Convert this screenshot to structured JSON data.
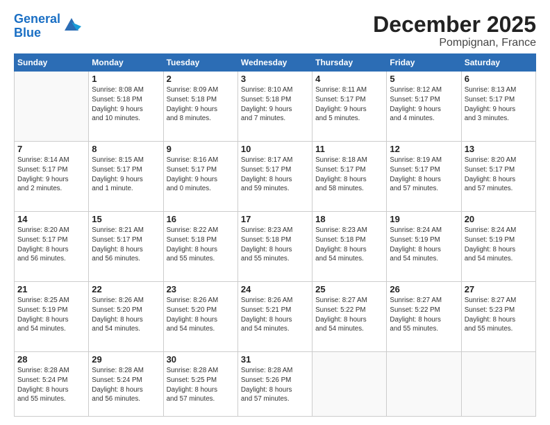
{
  "header": {
    "logo_line1": "General",
    "logo_line2": "Blue",
    "title": "December 2025",
    "subtitle": "Pompignan, France"
  },
  "days": [
    "Sunday",
    "Monday",
    "Tuesday",
    "Wednesday",
    "Thursday",
    "Friday",
    "Saturday"
  ],
  "weeks": [
    [
      {
        "date": "",
        "info": ""
      },
      {
        "date": "1",
        "info": "Sunrise: 8:08 AM\nSunset: 5:18 PM\nDaylight: 9 hours\nand 10 minutes."
      },
      {
        "date": "2",
        "info": "Sunrise: 8:09 AM\nSunset: 5:18 PM\nDaylight: 9 hours\nand 8 minutes."
      },
      {
        "date": "3",
        "info": "Sunrise: 8:10 AM\nSunset: 5:18 PM\nDaylight: 9 hours\nand 7 minutes."
      },
      {
        "date": "4",
        "info": "Sunrise: 8:11 AM\nSunset: 5:17 PM\nDaylight: 9 hours\nand 5 minutes."
      },
      {
        "date": "5",
        "info": "Sunrise: 8:12 AM\nSunset: 5:17 PM\nDaylight: 9 hours\nand 4 minutes."
      },
      {
        "date": "6",
        "info": "Sunrise: 8:13 AM\nSunset: 5:17 PM\nDaylight: 9 hours\nand 3 minutes."
      }
    ],
    [
      {
        "date": "7",
        "info": "Sunrise: 8:14 AM\nSunset: 5:17 PM\nDaylight: 9 hours\nand 2 minutes."
      },
      {
        "date": "8",
        "info": "Sunrise: 8:15 AM\nSunset: 5:17 PM\nDaylight: 9 hours\nand 1 minute."
      },
      {
        "date": "9",
        "info": "Sunrise: 8:16 AM\nSunset: 5:17 PM\nDaylight: 9 hours\nand 0 minutes."
      },
      {
        "date": "10",
        "info": "Sunrise: 8:17 AM\nSunset: 5:17 PM\nDaylight: 8 hours\nand 59 minutes."
      },
      {
        "date": "11",
        "info": "Sunrise: 8:18 AM\nSunset: 5:17 PM\nDaylight: 8 hours\nand 58 minutes."
      },
      {
        "date": "12",
        "info": "Sunrise: 8:19 AM\nSunset: 5:17 PM\nDaylight: 8 hours\nand 57 minutes."
      },
      {
        "date": "13",
        "info": "Sunrise: 8:20 AM\nSunset: 5:17 PM\nDaylight: 8 hours\nand 57 minutes."
      }
    ],
    [
      {
        "date": "14",
        "info": "Sunrise: 8:20 AM\nSunset: 5:17 PM\nDaylight: 8 hours\nand 56 minutes."
      },
      {
        "date": "15",
        "info": "Sunrise: 8:21 AM\nSunset: 5:17 PM\nDaylight: 8 hours\nand 56 minutes."
      },
      {
        "date": "16",
        "info": "Sunrise: 8:22 AM\nSunset: 5:18 PM\nDaylight: 8 hours\nand 55 minutes."
      },
      {
        "date": "17",
        "info": "Sunrise: 8:23 AM\nSunset: 5:18 PM\nDaylight: 8 hours\nand 55 minutes."
      },
      {
        "date": "18",
        "info": "Sunrise: 8:23 AM\nSunset: 5:18 PM\nDaylight: 8 hours\nand 54 minutes."
      },
      {
        "date": "19",
        "info": "Sunrise: 8:24 AM\nSunset: 5:19 PM\nDaylight: 8 hours\nand 54 minutes."
      },
      {
        "date": "20",
        "info": "Sunrise: 8:24 AM\nSunset: 5:19 PM\nDaylight: 8 hours\nand 54 minutes."
      }
    ],
    [
      {
        "date": "21",
        "info": "Sunrise: 8:25 AM\nSunset: 5:19 PM\nDaylight: 8 hours\nand 54 minutes."
      },
      {
        "date": "22",
        "info": "Sunrise: 8:26 AM\nSunset: 5:20 PM\nDaylight: 8 hours\nand 54 minutes."
      },
      {
        "date": "23",
        "info": "Sunrise: 8:26 AM\nSunset: 5:20 PM\nDaylight: 8 hours\nand 54 minutes."
      },
      {
        "date": "24",
        "info": "Sunrise: 8:26 AM\nSunset: 5:21 PM\nDaylight: 8 hours\nand 54 minutes."
      },
      {
        "date": "25",
        "info": "Sunrise: 8:27 AM\nSunset: 5:22 PM\nDaylight: 8 hours\nand 54 minutes."
      },
      {
        "date": "26",
        "info": "Sunrise: 8:27 AM\nSunset: 5:22 PM\nDaylight: 8 hours\nand 55 minutes."
      },
      {
        "date": "27",
        "info": "Sunrise: 8:27 AM\nSunset: 5:23 PM\nDaylight: 8 hours\nand 55 minutes."
      }
    ],
    [
      {
        "date": "28",
        "info": "Sunrise: 8:28 AM\nSunset: 5:24 PM\nDaylight: 8 hours\nand 55 minutes."
      },
      {
        "date": "29",
        "info": "Sunrise: 8:28 AM\nSunset: 5:24 PM\nDaylight: 8 hours\nand 56 minutes."
      },
      {
        "date": "30",
        "info": "Sunrise: 8:28 AM\nSunset: 5:25 PM\nDaylight: 8 hours\nand 57 minutes."
      },
      {
        "date": "31",
        "info": "Sunrise: 8:28 AM\nSunset: 5:26 PM\nDaylight: 8 hours\nand 57 minutes."
      },
      {
        "date": "",
        "info": ""
      },
      {
        "date": "",
        "info": ""
      },
      {
        "date": "",
        "info": ""
      }
    ]
  ]
}
